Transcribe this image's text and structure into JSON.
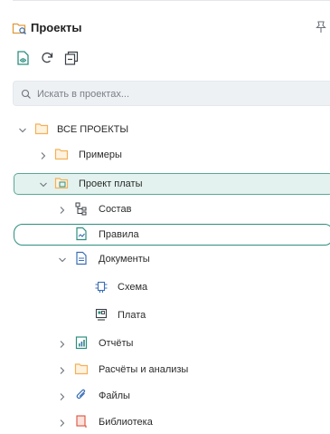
{
  "panel": {
    "title": "Проекты",
    "icons": {
      "title": "project-folder-icon",
      "pin": "pin-icon"
    }
  },
  "toolbar": {
    "buttons": [
      {
        "name": "add-project-button",
        "icon": "document-eye-icon"
      },
      {
        "name": "refresh-button",
        "icon": "refresh-icon"
      },
      {
        "name": "collapse-all-button",
        "icon": "collapse-all-icon"
      }
    ]
  },
  "search": {
    "placeholder": "Искать в проектах..."
  },
  "tree": {
    "items": [
      {
        "label": "ВСЕ ПРОЕКТЫ",
        "icon": "folder-icon",
        "chevron": "chevron-down-icon"
      },
      {
        "label": "Примеры",
        "icon": "folder-icon",
        "chevron": "chevron-right-icon"
      },
      {
        "label": "Проект платы",
        "icon": "project-board-icon",
        "chevron": "chevron-down-icon",
        "selected": true
      },
      {
        "label": "Состав",
        "icon": "hierarchy-icon",
        "chevron": "chevron-right-icon"
      },
      {
        "label": "Правила",
        "icon": "rules-icon",
        "focused": true
      },
      {
        "label": "Документы",
        "icon": "documents-icon",
        "chevron": "chevron-down-icon"
      },
      {
        "label": "Схема",
        "icon": "schematic-icon"
      },
      {
        "label": "Плата",
        "icon": "board-icon"
      },
      {
        "label": "Отчёты",
        "icon": "report-icon",
        "chevron": "chevron-right-icon"
      },
      {
        "label": "Расчёты и анализы",
        "icon": "folder-icon",
        "chevron": "chevron-right-icon"
      },
      {
        "label": "Файлы",
        "icon": "paperclip-icon",
        "chevron": "chevron-right-icon"
      },
      {
        "label": "Библиотека",
        "icon": "library-icon",
        "chevron": "chevron-right-icon"
      }
    ]
  },
  "colors": {
    "accent": "#2c8f7f",
    "selection_bg": "#e3f2ee",
    "folder": "#f2b15a",
    "icon_blue": "#3b6fb6"
  }
}
